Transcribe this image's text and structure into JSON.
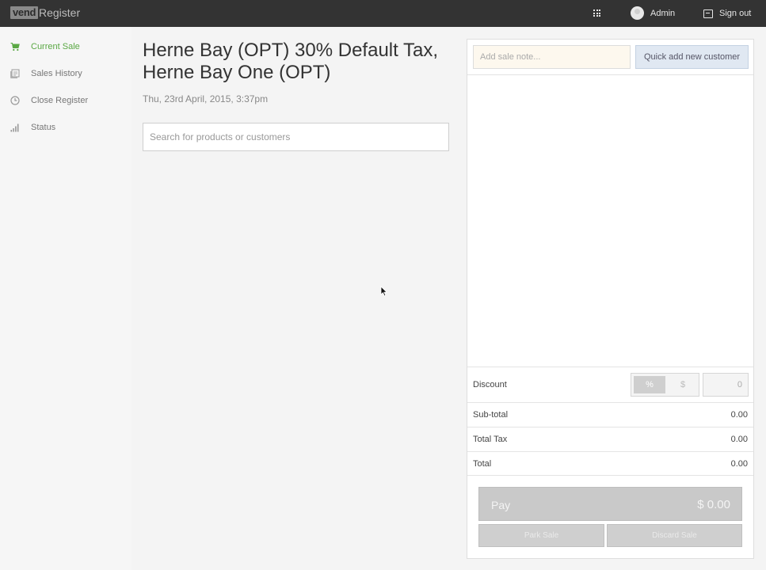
{
  "header": {
    "logo_text": "vend",
    "app_title": "Register",
    "user_name": "Admin",
    "signout_label": "Sign out",
    "apps_icon": "grid-icon"
  },
  "sidebar": {
    "items": [
      {
        "label": "Current Sale",
        "icon": "cart-icon",
        "active": true
      },
      {
        "label": "Sales History",
        "icon": "history-icon",
        "active": false
      },
      {
        "label": "Close Register",
        "icon": "clock-icon",
        "active": false
      },
      {
        "label": "Status",
        "icon": "signal-icon",
        "active": false
      }
    ]
  },
  "main": {
    "title": "Herne Bay (OPT) 30% Default Tax, Herne Bay One (OPT)",
    "date": "Thu, 23rd April, 2015, 3:37pm",
    "search_placeholder": "Search for products or customers"
  },
  "sale": {
    "note_placeholder": "Add sale note...",
    "quick_add_label": "Quick add new customer",
    "discount_label": "Discount",
    "discount_pct_label": "%",
    "discount_dollar_label": "$",
    "discount_value": "0",
    "subtotal_label": "Sub-total",
    "subtotal_value": "0.00",
    "tax_label": "Total Tax",
    "tax_value": "0.00",
    "total_label": "Total",
    "total_value": "0.00",
    "pay_label": "Pay",
    "pay_amount": "$ 0.00",
    "park_label": "Park Sale",
    "discard_label": "Discard Sale"
  },
  "colors": {
    "topbar": "#333333",
    "accent_green": "#5aa844",
    "sidebar_bg": "#f6f6f6",
    "pay_button": "#c9c9c9"
  }
}
